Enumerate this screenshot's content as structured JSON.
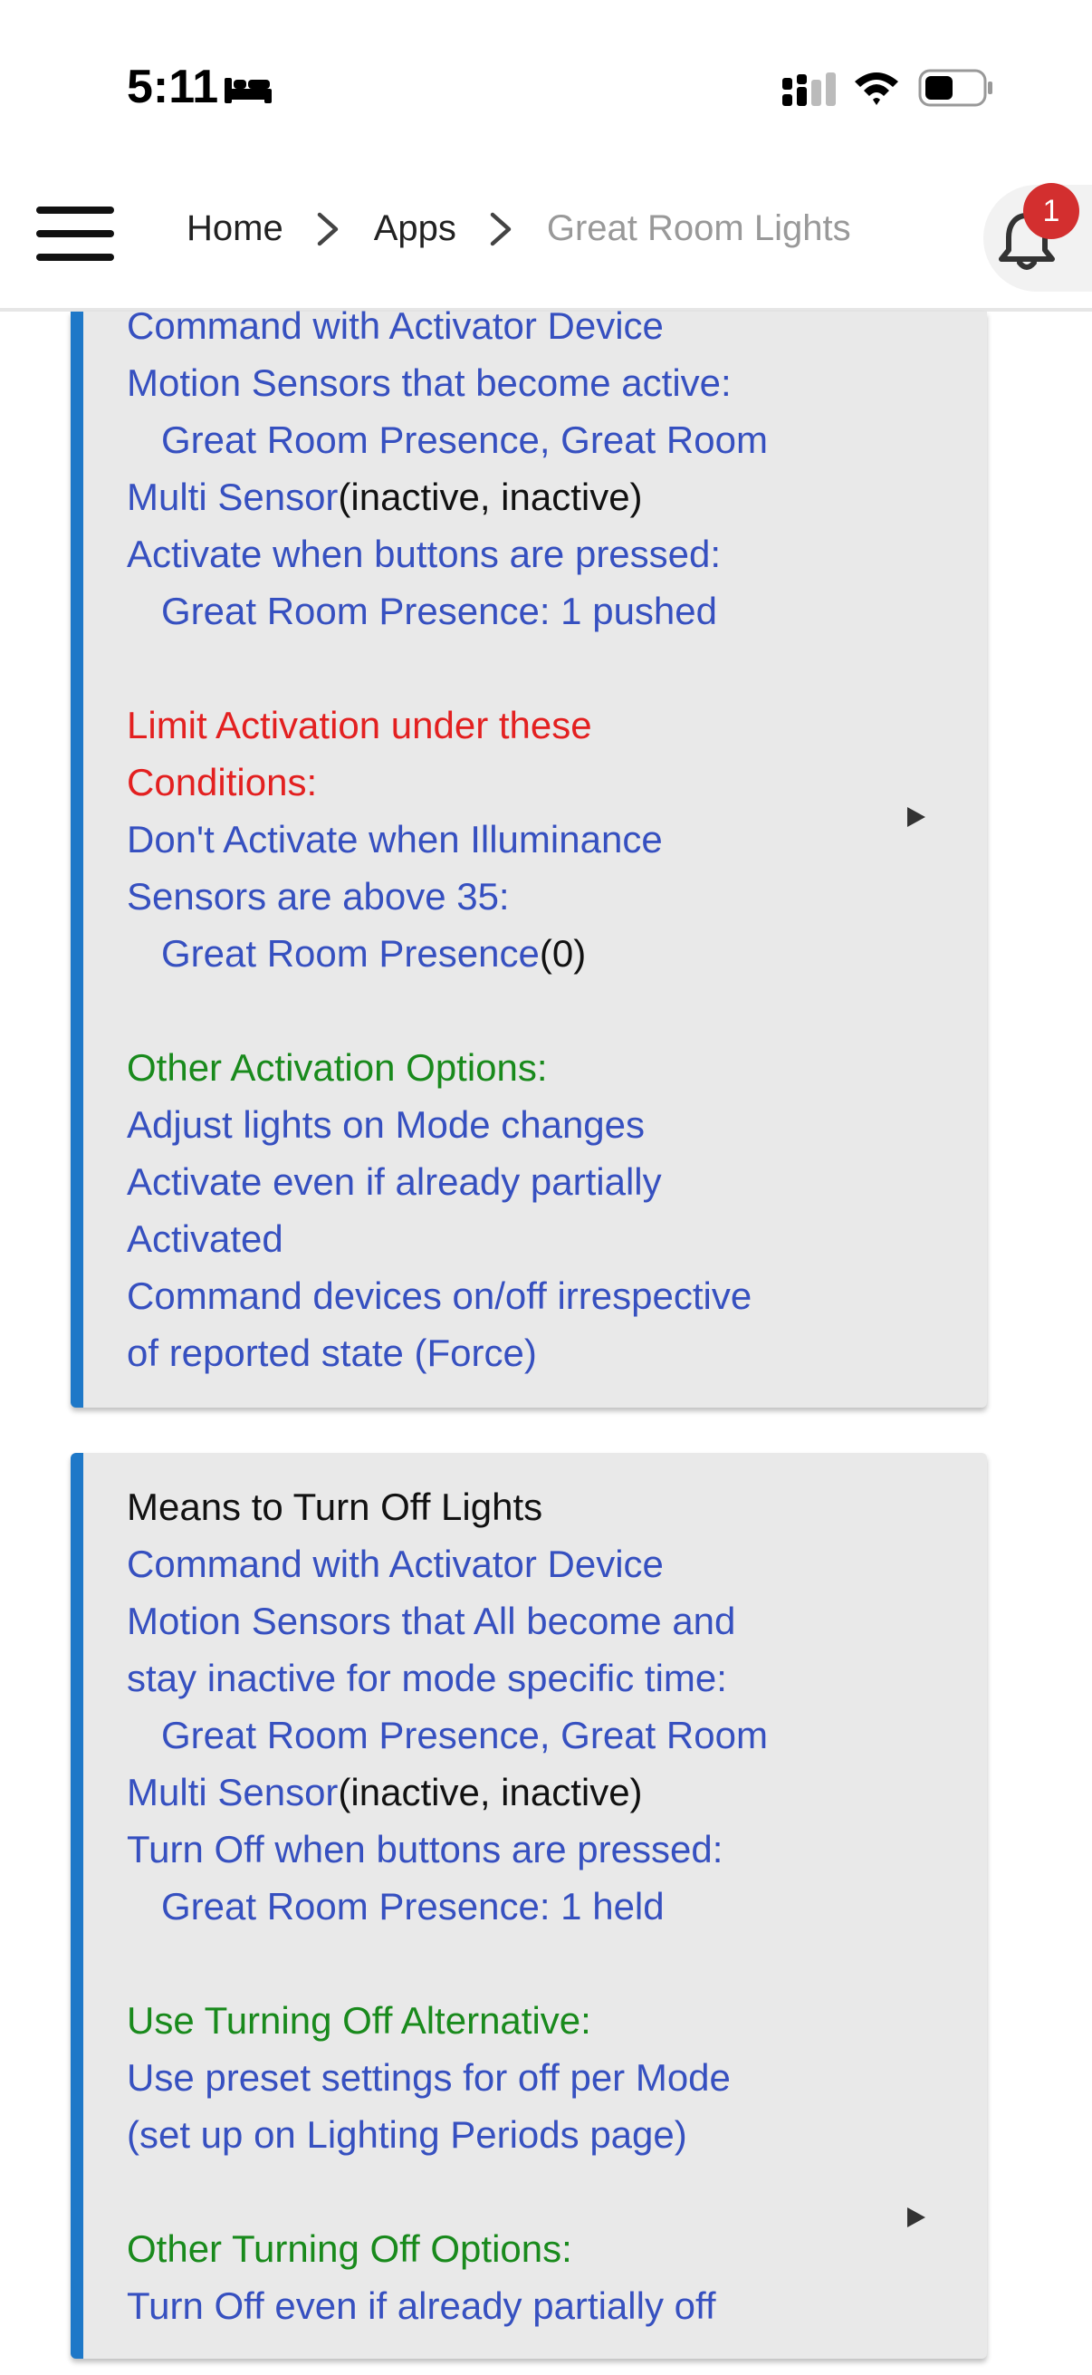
{
  "status_bar": {
    "time": "5:11"
  },
  "header": {
    "breadcrumbs": [
      {
        "label": "Home"
      },
      {
        "label": "Apps"
      },
      {
        "label": "Great Room Lights"
      }
    ],
    "notification_count": "1"
  },
  "card1": {
    "command_activator": "Command with Activator Device",
    "motion_active_label": "Motion Sensors that become active:",
    "motion_devices_a": "Great Room Presence, Great Room",
    "motion_devices_b": "Multi Sensor",
    "motion_states": "(inactive, inactive)",
    "buttons_label": "Activate when buttons are pressed:",
    "buttons_value": "Great Room Presence: 1 pushed",
    "limit_heading_a": "Limit Activation under these",
    "limit_heading_b": "Conditions:",
    "illuminance_a": "Don't Activate when Illuminance",
    "illuminance_b": "Sensors are above 35:",
    "illuminance_device": "Great Room Presence",
    "illuminance_value": "(0)",
    "other_heading": "Other Activation Options:",
    "option_1": "Adjust lights on Mode changes",
    "option_2a": "Activate even if already partially",
    "option_2b": "Activated",
    "option_3a": "Command devices on/off irrespective",
    "option_3b": "of reported state (Force)"
  },
  "card2": {
    "title": "Means to Turn Off Lights",
    "command_activator": "Command with Activator Device",
    "motion_label_a": "Motion Sensors that All become and",
    "motion_label_b": "stay inactive for mode specific time:",
    "motion_devices_a": "Great Room Presence, Great Room",
    "motion_devices_b": "Multi Sensor",
    "motion_states": "(inactive, inactive)",
    "buttons_label": "Turn Off when buttons are pressed:",
    "buttons_value": "Great Room Presence: 1 held",
    "alt_heading": "Use Turning Off Alternative:",
    "alt_a": "Use preset settings for off per Mode",
    "alt_b": "(set up on Lighting Periods page)",
    "other_heading": "Other Turning Off Options:",
    "other_1": "Turn Off even if already partially off"
  }
}
